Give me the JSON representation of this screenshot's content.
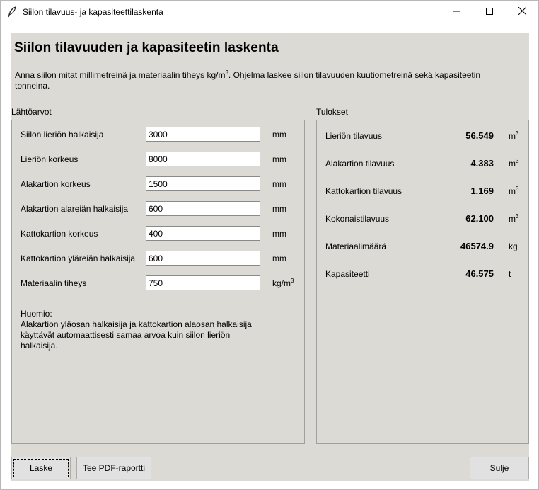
{
  "window": {
    "title": "Siilon tilavuus- ja kapasiteettilaskenta",
    "icons": {
      "app": "feather-icon",
      "minimize": "minimize-icon",
      "maximize": "maximize-icon",
      "close": "close-icon"
    }
  },
  "page": {
    "heading": "Siilon tilavuuden ja kapasiteetin laskenta",
    "intro_before": "Anna siilon mitat millimetreinä ja materiaalin tiheys kg/m",
    "intro_sup": "3",
    "intro_after": ". Ohjelma laskee siilon tilavuuden kuutiometreinä sekä kapasiteetin tonneina."
  },
  "inputs": {
    "group_label": "Lähtöarvot",
    "fields": [
      {
        "label": "Siilon lieriön halkaisija",
        "value": "3000",
        "unit": "mm"
      },
      {
        "label": "Lieriön korkeus",
        "value": "8000",
        "unit": "mm"
      },
      {
        "label": "Alakartion korkeus",
        "value": "1500",
        "unit": "mm"
      },
      {
        "label": "Alakartion alareiän halkaisija",
        "value": "600",
        "unit": "mm"
      },
      {
        "label": "Kattokartion korkeus",
        "value": "400",
        "unit": "mm"
      },
      {
        "label": "Kattokartion yläreiän halkaisija",
        "value": "600",
        "unit": "mm"
      },
      {
        "label": "Materiaalin tiheys",
        "value": "750",
        "unit": "kg/m",
        "unit_sup": "3"
      }
    ],
    "note": {
      "title": "Huomio:",
      "line1": "Alakartion yläosan halkaisija ja kattokartion alaosan halkaisija",
      "line2": "käyttävät automaattisesti samaa arvoa kuin siilon lieriön",
      "line3": "halkaisija."
    }
  },
  "results": {
    "group_label": "Tulokset",
    "rows": [
      {
        "label": "Lieriön tilavuus",
        "value": "56.549",
        "unit": "m",
        "unit_sup": "3"
      },
      {
        "label": "Alakartion tilavuus",
        "value": "4.383",
        "unit": "m",
        "unit_sup": "3"
      },
      {
        "label": "Kattokartion tilavuus",
        "value": "1.169",
        "unit": "m",
        "unit_sup": "3"
      },
      {
        "label": "Kokonaistilavuus",
        "value": "62.100",
        "unit": "m",
        "unit_sup": "3"
      },
      {
        "label": "Materiaalimäärä",
        "value": "46574.9",
        "unit": "kg",
        "unit_sup": ""
      },
      {
        "label": "Kapasiteetti",
        "value": "46.575",
        "unit": "t",
        "unit_sup": ""
      }
    ]
  },
  "buttons": {
    "calculate": "Laske",
    "pdf": "Tee PDF-raportti",
    "quit": "Sulje"
  }
}
